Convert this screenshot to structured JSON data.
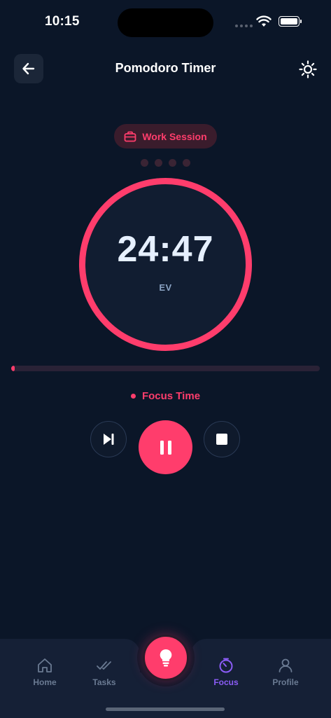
{
  "status_bar": {
    "time": "10:15"
  },
  "header": {
    "title": "Pomodoro Timer",
    "back_icon": "arrow-left-icon",
    "theme_icon": "sun-icon"
  },
  "session": {
    "label": "Work Session",
    "icon": "briefcase-icon",
    "completed_dots": 0,
    "total_dots": 4
  },
  "timer": {
    "display": "24:47",
    "sub_label": "EV",
    "progress_fraction": 0.012
  },
  "mode": {
    "label": "Focus Time"
  },
  "controls": {
    "skip_icon": "skip-forward-icon",
    "pause_icon": "pause-icon",
    "stop_icon": "stop-icon"
  },
  "tabs": [
    {
      "label": "Home",
      "icon": "home-icon",
      "active": false
    },
    {
      "label": "Tasks",
      "icon": "check-double-icon",
      "active": false
    },
    {
      "label": "Focus",
      "icon": "timer-icon",
      "active": true
    },
    {
      "label": "Profile",
      "icon": "user-icon",
      "active": false
    }
  ],
  "fab": {
    "icon": "lightbulb-icon"
  },
  "colors": {
    "background": "#0b1628",
    "accent": "#ff3d6c",
    "active_tab": "#8b5cf6",
    "muted": "#6a7a92"
  }
}
